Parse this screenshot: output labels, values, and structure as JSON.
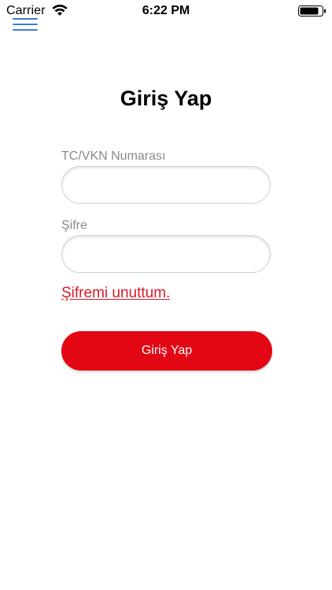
{
  "status_bar": {
    "carrier": "Carrier",
    "time": "6:22 PM",
    "icons": [
      "wifi-icon",
      "battery-icon"
    ]
  },
  "nav": {
    "menu_icon": "hamburger-menu-icon",
    "accent_color": "#3d7fd6"
  },
  "login": {
    "title": "Giriş Yap",
    "id_label": "TC/VKN Numarası",
    "id_value": "",
    "password_label": "Şifre",
    "password_value": "",
    "forgot_password": "Şifremi unuttum.",
    "submit_label": "Giriş Yap",
    "brand_color": "#e30613"
  }
}
